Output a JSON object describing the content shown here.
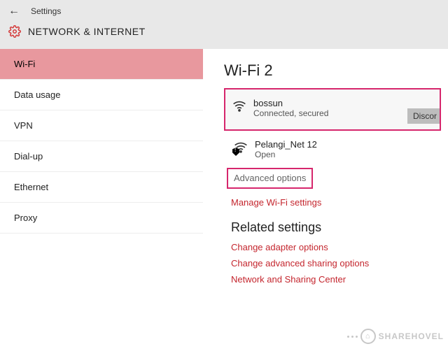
{
  "header": {
    "title": "Settings",
    "section": "NETWORK & INTERNET"
  },
  "sidebar": {
    "items": [
      {
        "label": "Wi-Fi",
        "active": true
      },
      {
        "label": "Data usage",
        "active": false
      },
      {
        "label": "VPN",
        "active": false
      },
      {
        "label": "Dial-up",
        "active": false
      },
      {
        "label": "Ethernet",
        "active": false
      },
      {
        "label": "Proxy",
        "active": false
      }
    ]
  },
  "main": {
    "heading": "Wi-Fi 2",
    "connected": {
      "ssid": "bossun",
      "status": "Connected, secured",
      "button": "Discor"
    },
    "other": {
      "ssid": "Pelangi_Net 12",
      "status": "Open"
    },
    "advanced": "Advanced options",
    "manage": "Manage Wi-Fi settings",
    "related_heading": "Related settings",
    "related": [
      "Change adapter options",
      "Change advanced sharing options",
      "Network and Sharing Center"
    ]
  },
  "watermark": "SHAREHOVEL"
}
